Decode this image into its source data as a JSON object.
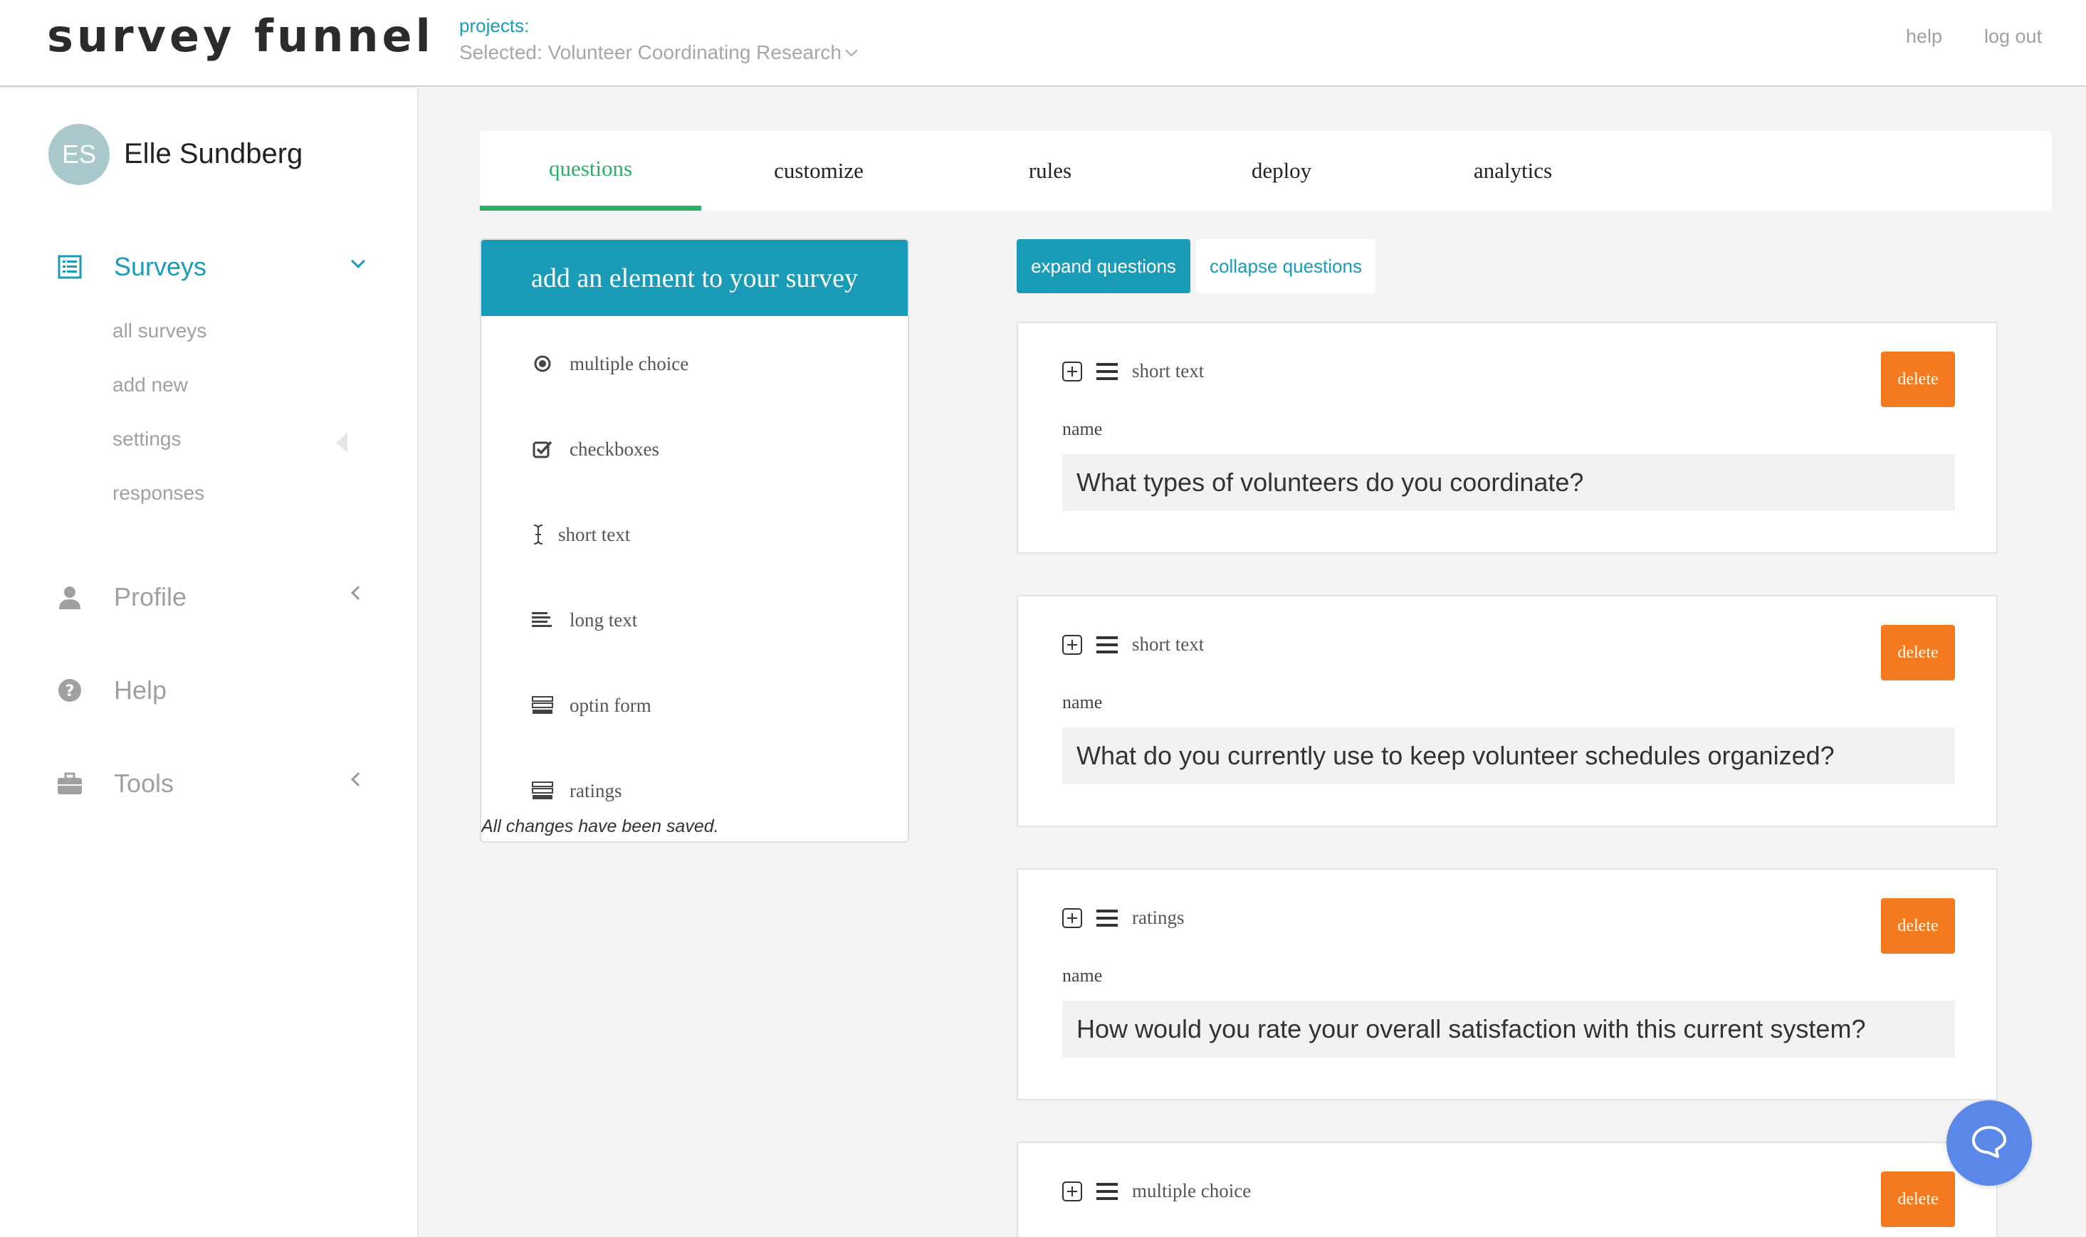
{
  "header": {
    "logo": "survey funnel",
    "projects_label": "projects:",
    "projects_selected": "Selected: Volunteer Coordinating Research",
    "help": "help",
    "logout": "log out"
  },
  "user": {
    "initials": "ES",
    "name": "Elle Sundberg"
  },
  "sidebar": {
    "surveys": "Surveys",
    "sub_items": [
      "all surveys",
      "add new",
      "settings",
      "responses"
    ],
    "profile": "Profile",
    "help": "Help",
    "tools": "Tools"
  },
  "tabs": [
    "questions",
    "customize",
    "rules",
    "deploy",
    "analytics"
  ],
  "active_tab": "questions",
  "palette": {
    "title": "add an element to your survey",
    "items": [
      {
        "label": "multiple choice",
        "icon": "radio-icon"
      },
      {
        "label": "checkboxes",
        "icon": "checkbox-icon"
      },
      {
        "label": "short text",
        "icon": "text-cursor-icon"
      },
      {
        "label": "long text",
        "icon": "paragraph-icon"
      },
      {
        "label": "optin form",
        "icon": "form-icon"
      },
      {
        "label": "ratings",
        "icon": "ratings-icon"
      }
    ],
    "saved_status": "All changes have been saved."
  },
  "buttons": {
    "expand": "expand questions",
    "collapse": "collapse questions"
  },
  "questions": [
    {
      "type": "short text",
      "delete": "delete",
      "name_label": "name",
      "name_value": "What types of volunteers do you coordinate?"
    },
    {
      "type": "short text",
      "delete": "delete",
      "name_label": "name",
      "name_value": "What do you currently use to keep volunteer schedules organized?"
    },
    {
      "type": "ratings",
      "delete": "delete",
      "name_label": "name",
      "name_value": "How would you rate your overall satisfaction with this current system?"
    },
    {
      "type": "multiple choice",
      "delete": "delete"
    }
  ],
  "colors": {
    "accent": "#1a9bb8",
    "active_tab": "#2baf6a",
    "delete": "#f47a1f",
    "chat": "#5b88e8"
  }
}
